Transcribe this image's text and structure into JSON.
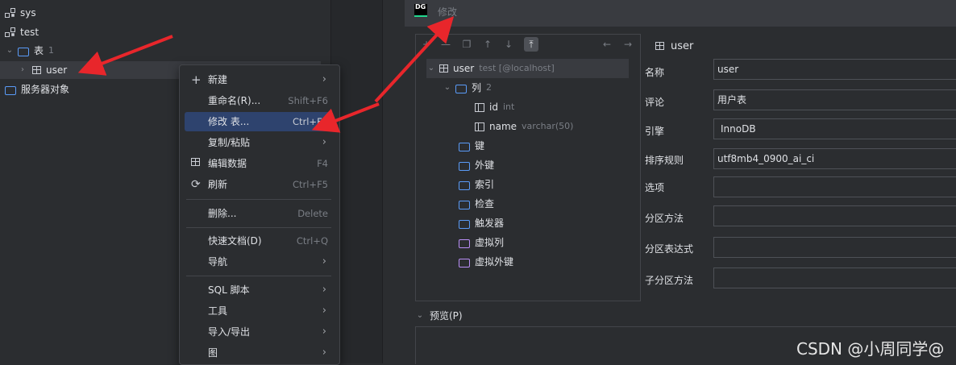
{
  "left_tree": {
    "items": [
      {
        "label": "sys"
      },
      {
        "label": "test"
      },
      {
        "label": "表",
        "count": "1"
      },
      {
        "label": "user"
      },
      {
        "label": "服务器对象"
      }
    ]
  },
  "context_menu": {
    "items": [
      {
        "label": "新建",
        "shortcut": "",
        "submenu": true
      },
      {
        "label": "重命名(R)...",
        "shortcut": "Shift+F6"
      },
      {
        "label": "修改 表...",
        "shortcut": "Ctrl+F6"
      },
      {
        "label": "复制/粘贴",
        "submenu": true
      },
      {
        "label": "编辑数据",
        "shortcut": "F4"
      },
      {
        "label": "刷新",
        "shortcut": "Ctrl+F5"
      },
      {
        "label": "删除...",
        "shortcut": "Delete"
      },
      {
        "label": "快速文档(D)",
        "shortcut": "Ctrl+Q"
      },
      {
        "label": "导航",
        "submenu": true
      },
      {
        "label": "SQL 脚本",
        "submenu": true
      },
      {
        "label": "工具",
        "submenu": true
      },
      {
        "label": "导入/导出",
        "submenu": true
      },
      {
        "label": "图",
        "submenu": true
      }
    ]
  },
  "dialog": {
    "logo": "DG",
    "title": "修改",
    "structure": {
      "table": "user",
      "table_sub": "test [@localhost]",
      "columns_label": "列",
      "columns_count": "2",
      "columns": [
        {
          "name": "id",
          "type": "int"
        },
        {
          "name": "name",
          "type": "varchar(50)"
        }
      ],
      "groups": [
        "键",
        "外键",
        "索引",
        "检查",
        "触发器"
      ],
      "virtual_groups": [
        "虚拟列",
        "虚拟外键"
      ]
    },
    "props_header": "user",
    "props": [
      {
        "label": "名称",
        "value": "user"
      },
      {
        "label": "评论",
        "value": "用户表"
      },
      {
        "label": "引擎",
        "value": "InnoDB"
      },
      {
        "label": "排序规则",
        "value": "utf8mb4_0900_ai_ci"
      },
      {
        "label": "选项",
        "value": ""
      },
      {
        "label": "分区方法",
        "value": ""
      },
      {
        "label": "分区表达式",
        "value": ""
      },
      {
        "label": "子分区方法",
        "value": ""
      }
    ],
    "preview_label": "预览(P)"
  },
  "watermark": "CSDN @小周同学@",
  "colors": {
    "arrow": "#e8262b",
    "selection": "#2e436e",
    "folder": "#5a9bf7",
    "virtual_folder": "#b88ef5"
  }
}
